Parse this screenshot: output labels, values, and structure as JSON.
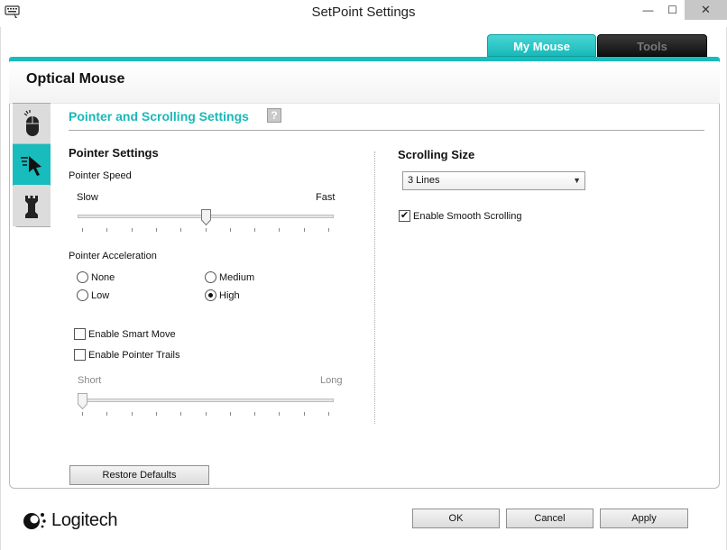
{
  "window": {
    "title": "SetPoint Settings",
    "minimize": "—",
    "maximize": "☐",
    "close": "✕"
  },
  "top_tabs": [
    {
      "label": "My Mouse",
      "active": true
    },
    {
      "label": "Tools",
      "active": false
    }
  ],
  "device": {
    "name": "Optical Mouse"
  },
  "side_tabs": [
    {
      "icon": "mouse-buttons-icon",
      "active": false
    },
    {
      "icon": "pointer-icon",
      "active": true
    },
    {
      "icon": "chess-rook-icon",
      "active": false
    }
  ],
  "section": {
    "title": "Pointer and Scrolling Settings",
    "help": "?"
  },
  "pointer": {
    "title": "Pointer Settings",
    "speed": {
      "label": "Pointer Speed",
      "min_label": "Slow",
      "max_label": "Fast",
      "level": 0.5
    },
    "acceleration": {
      "label": "Pointer Acceleration",
      "options": [
        "None",
        "Medium",
        "Low",
        "High"
      ],
      "selected": "High"
    },
    "smart_move": {
      "label": "Enable Smart Move",
      "checked": false
    },
    "pointer_trails": {
      "label": "Enable Pointer Trails",
      "checked": false
    },
    "trails_length": {
      "min_label": "Short",
      "max_label": "Long",
      "level": 0.0,
      "enabled": false
    }
  },
  "scrolling": {
    "title": "Scrolling Size",
    "size": "3 Lines",
    "smooth": {
      "label": "Enable Smooth Scrolling",
      "checked": true
    }
  },
  "buttons": {
    "restore": "Restore Defaults",
    "ok": "OK",
    "cancel": "Cancel",
    "apply": "Apply"
  },
  "brand": {
    "name": "Logitech"
  },
  "colors": {
    "accent": "#18bcbc",
    "accent_text": "#1ab8b8"
  }
}
